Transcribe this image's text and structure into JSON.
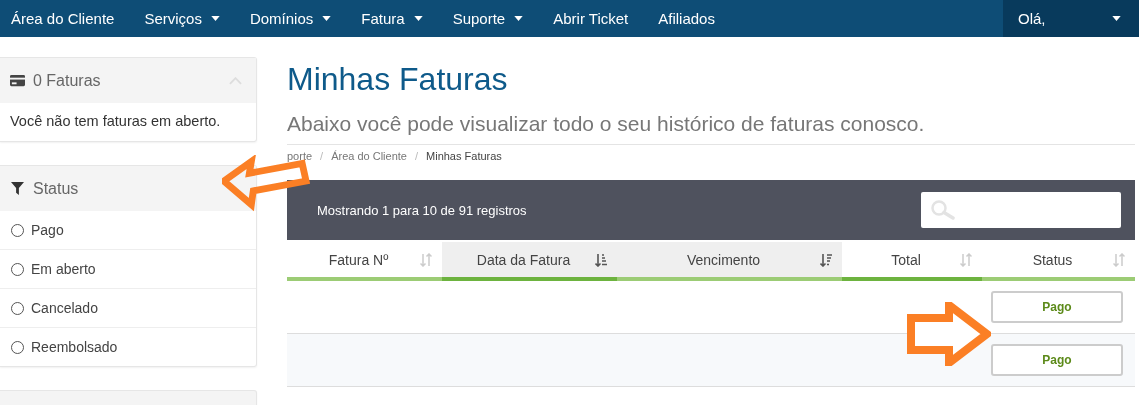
{
  "nav": {
    "items": [
      {
        "label": "Área do Cliente",
        "dropdown": false
      },
      {
        "label": "Serviços",
        "dropdown": true
      },
      {
        "label": "Domínios",
        "dropdown": true
      },
      {
        "label": "Fatura",
        "dropdown": true
      },
      {
        "label": "Suporte",
        "dropdown": true
      },
      {
        "label": "Abrir Ticket",
        "dropdown": false
      },
      {
        "label": "Afiliados",
        "dropdown": false
      }
    ],
    "account": {
      "label": "Olá,",
      "dropdown": true
    }
  },
  "sidebar": {
    "invoices_panel": {
      "title": "0 Faturas",
      "expanded": true,
      "message": "Você não tem faturas em aberto."
    },
    "status_panel": {
      "title": "Status",
      "options": [
        {
          "label": "Pago",
          "selected": false
        },
        {
          "label": "Em aberto",
          "selected": false
        },
        {
          "label": "Cancelado",
          "selected": false
        },
        {
          "label": "Reembolsado",
          "selected": false
        }
      ]
    }
  },
  "page": {
    "title": "Minhas Faturas",
    "subtitle": "Abaixo você pode visualizar todo o seu histórico de faturas conosco.",
    "breadcrumb": [
      {
        "label": "porte",
        "current": false
      },
      {
        "separator": "/",
        "label": "Área do Cliente",
        "current": false
      },
      {
        "separator": "/",
        "label": "Minhas Faturas",
        "current": true
      }
    ]
  },
  "table": {
    "info": "Mostrando 1 para 10 de 91 registros",
    "columns": [
      {
        "label": "Fatura Nº",
        "sorted": false,
        "shaded": false,
        "accent": false
      },
      {
        "label": "Data da Fatura",
        "sorted": true,
        "descending": false,
        "shaded": true,
        "accent": true
      },
      {
        "label": "Vencimento",
        "sorted": true,
        "descending": true,
        "shaded": true,
        "accent": false
      },
      {
        "label": "Total",
        "sorted": false,
        "shaded": false,
        "accent": true
      },
      {
        "label": "Status",
        "sorted": false,
        "shaded": false,
        "accent": false
      }
    ],
    "rows": [
      {
        "status": "Pago"
      },
      {
        "status": "Pago"
      }
    ]
  }
}
